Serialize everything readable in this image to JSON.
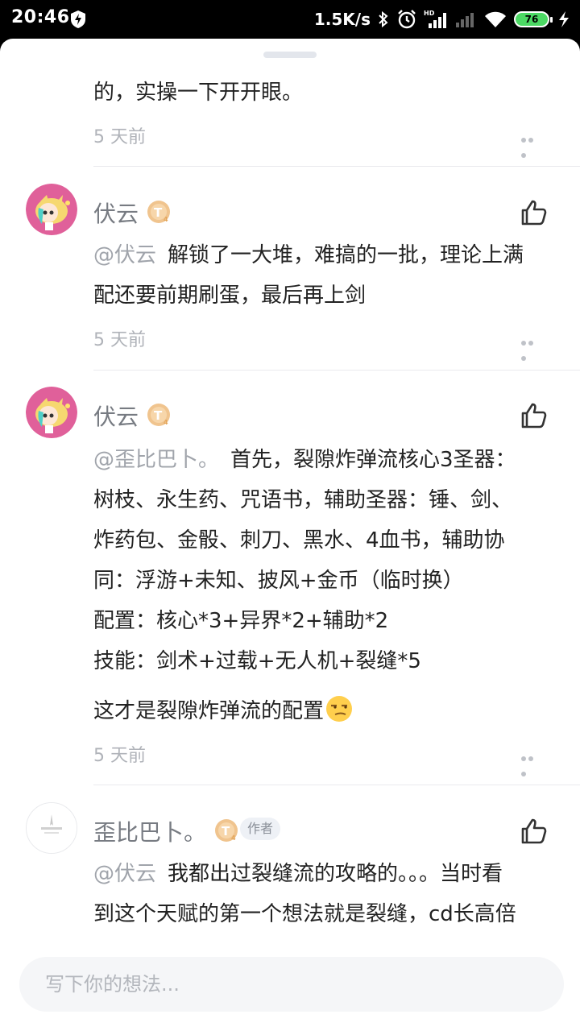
{
  "status_bar": {
    "time": "20:46",
    "net_speed": "1.5K/s",
    "battery": "76"
  },
  "comments": [
    {
      "text": "的，实操一下开开眼。",
      "time": "5 天前"
    },
    {
      "user": "伏云",
      "level": "T",
      "mention": "@伏云",
      "lines": [
        "解锁了一大堆，难搞的一批，理论上满",
        "配还要前期刷蛋，最后再上剑"
      ],
      "time": "5 天前"
    },
    {
      "user": "伏云",
      "level": "T",
      "mention": "@歪比巴卜。",
      "lines": [
        "首先，裂隙炸弹流核心3圣器：",
        "树枝、永生药、咒语书，辅助圣器：锤、剑、",
        "炸药包、金骰、刺刀、黑水、4血书，辅助协",
        "同：浮游+未知、披风+金币（临时换）",
        "配置：核心*3+异界*2+辅助*2",
        "技能：剑术+过载+无人机+裂缝*5"
      ],
      "extra": "这才是裂隙炸弹流的配置",
      "emoji": "smirk-emoji",
      "time": "5 天前"
    },
    {
      "user": "歪比巴卜。",
      "level": "T",
      "badge": "作者",
      "mention": "@伏云",
      "lines": [
        "我都出过裂缝流的攻略的。。。当时看",
        "到这个天赋的第一个想法就是裂缝，cd长高倍"
      ]
    }
  ],
  "input": {
    "placeholder": "写下你的想法..."
  },
  "icons": {
    "like": "thumbs-up-icon",
    "more": "more-dots-icon",
    "level": "level-badge-icon"
  },
  "colors": {
    "text": "#222222",
    "muted": "#b0b3b9",
    "username": "#777b82",
    "badge": "#f0c48e"
  }
}
